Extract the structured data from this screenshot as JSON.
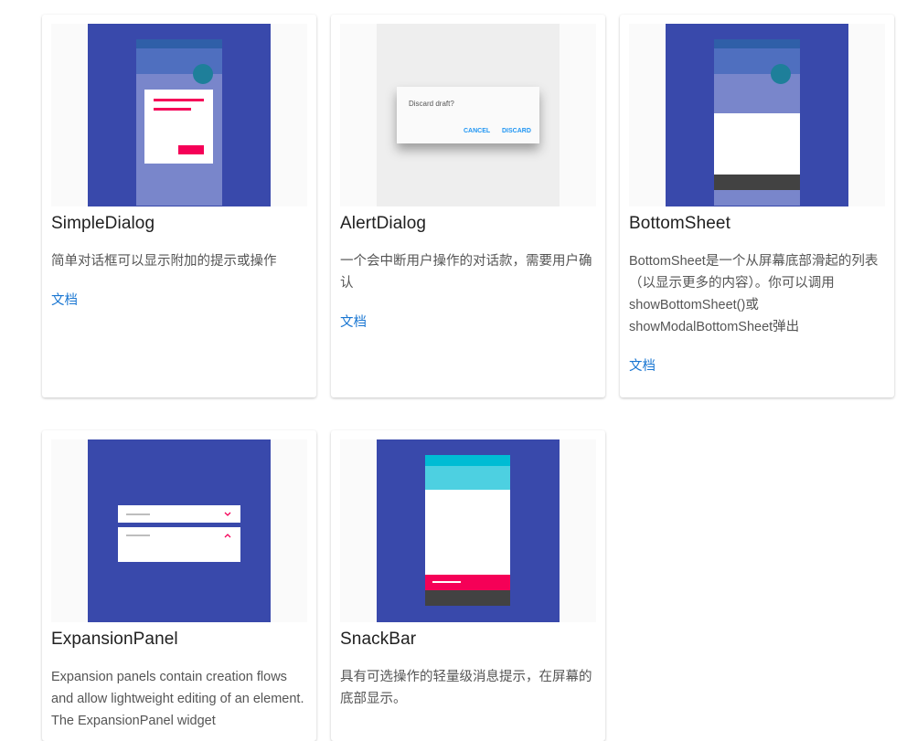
{
  "cards": [
    {
      "title": "SimpleDialog",
      "description": "简单对话框可以显示附加的提示或操作",
      "doc_label": "文档"
    },
    {
      "title": "AlertDialog",
      "description": "一个会中断用户操作的对话款，需要用户确认",
      "doc_label": "文档",
      "preview": {
        "dialog_text": "Discard draft?",
        "cancel_label": "CANCEL",
        "discard_label": "DISCARD"
      }
    },
    {
      "title": "BottomSheet",
      "description": "BottomSheet是一个从屏幕底部滑起的列表（以显示更多的内容）。你可以调用showBottomSheet()或showModalBottomSheet弹出",
      "doc_label": "文档"
    },
    {
      "title": "ExpansionPanel",
      "description": "Expansion panels contain creation flows and allow lightweight editing of an element. The ExpansionPanel widget"
    },
    {
      "title": "SnackBar",
      "description": "具有可选操作的轻量级消息提示，在屏幕的底部显示。"
    }
  ],
  "colors": {
    "indigo": "#3949ab",
    "pink": "#f50057",
    "link": "#1976d2",
    "cyan": "#00bcd4"
  }
}
